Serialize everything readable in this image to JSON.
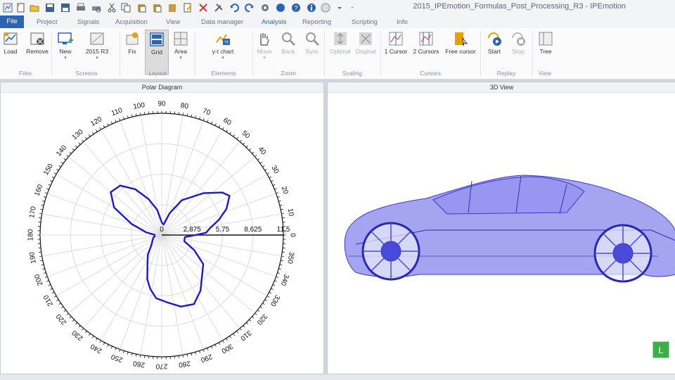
{
  "window": {
    "title": "2015_IPEmotion_Formulas_Post_Processing_R3 - IPEmotion"
  },
  "tabs": [
    "File",
    "Project",
    "Signals",
    "Acquisition",
    "View",
    "Data manager",
    "Analysis",
    "Reporting",
    "Scripting",
    "Info"
  ],
  "ribbon": {
    "buttons": [
      "Load",
      "Remove",
      "New",
      "2015 R3",
      "Fix",
      "Grid",
      "Area",
      "y-t chart",
      "Move",
      "Back",
      "Sync",
      "Optimal",
      "Original",
      "1 Cursor",
      "2 Cursors",
      "Free cursor",
      "Start",
      "Stop",
      "Tree"
    ],
    "groups": [
      "Files",
      "Screens",
      "Layout",
      "Elements",
      "Zoom",
      "Scaling",
      "Cursors",
      "Replay",
      "View"
    ]
  },
  "panes": {
    "polar": {
      "title": "Polar Diagram",
      "radial_labels": [
        "0",
        "2,875",
        "5,75",
        "8,625",
        "11,5"
      ],
      "angle_labels": [
        "0",
        "10",
        "20",
        "30",
        "40",
        "50",
        "60",
        "70",
        "80",
        "90",
        "100",
        "110",
        "120",
        "130",
        "140",
        "150",
        "160",
        "170",
        "180",
        "190",
        "200",
        "210",
        "220",
        "230",
        "240",
        "250",
        "260",
        "270",
        "280",
        "290",
        "300",
        "310",
        "320",
        "330",
        "340",
        "350"
      ]
    },
    "view3d": {
      "title": "3D View",
      "badge": "L"
    }
  },
  "colors": {
    "accent": "#2a64b4",
    "plot_line": "#1a1acc",
    "car": "#5a5ae6",
    "badge": "#3fae49"
  },
  "chart_data": {
    "type": "line",
    "coordinate_system": "polar",
    "radial_ticks": [
      0,
      2.875,
      5.75,
      8.625,
      11.5
    ],
    "rlim": [
      0,
      11.5
    ],
    "angle_ticks_deg": [
      0,
      10,
      20,
      30,
      40,
      50,
      60,
      70,
      80,
      90,
      100,
      110,
      120,
      130,
      140,
      150,
      160,
      170,
      180,
      190,
      200,
      210,
      220,
      230,
      240,
      250,
      260,
      270,
      280,
      290,
      300,
      310,
      320,
      330,
      340,
      350
    ],
    "grid": true,
    "series": [
      {
        "points_deg_r": [
          [
            180,
            0.6
          ],
          [
            170,
            1.5
          ],
          [
            160,
            3.0
          ],
          [
            150,
            5.2
          ],
          [
            140,
            6.3
          ],
          [
            130,
            6.1
          ],
          [
            120,
            5.0
          ],
          [
            110,
            3.6
          ],
          [
            100,
            2.4
          ],
          [
            90,
            1.2
          ],
          [
            80,
            1.0
          ],
          [
            70,
            2.2
          ],
          [
            60,
            3.8
          ],
          [
            45,
            5.6
          ],
          [
            35,
            7.0
          ],
          [
            30,
            7.4
          ],
          [
            22,
            6.6
          ],
          [
            15,
            5.6
          ],
          [
            8,
            4.6
          ],
          [
            3,
            4.2
          ],
          [
            0,
            3.2
          ],
          [
            355,
            2.2
          ],
          [
            345,
            2.2
          ],
          [
            335,
            3.4
          ],
          [
            325,
            4.8
          ],
          [
            315,
            5.4
          ],
          [
            305,
            6.4
          ],
          [
            295,
            7.2
          ],
          [
            285,
            7.0
          ],
          [
            275,
            6.4
          ],
          [
            265,
            6.0
          ],
          [
            258,
            5.2
          ],
          [
            252,
            4.4
          ],
          [
            245,
            3.2
          ],
          [
            235,
            2.3
          ],
          [
            225,
            1.4
          ],
          [
            210,
            1.0
          ],
          [
            195,
            0.8
          ],
          [
            185,
            0.6
          ]
        ]
      }
    ]
  }
}
